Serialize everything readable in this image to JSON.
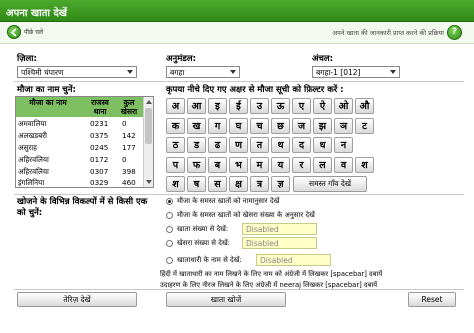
{
  "title": "अपना खाता देखें",
  "subbar": {
    "back_label": "पीछे चलें",
    "help_text": "अपने खाता की जानकारी प्राप्त करने की प्रक्रिया",
    "help_icon": "?"
  },
  "filters": {
    "district": {
      "label": "ज़िला:",
      "value": "पश्चिमी चंपारण"
    },
    "subdivision": {
      "label": "अनुमंडल:",
      "value": "बगहा"
    },
    "circle": {
      "label": "अंचल:",
      "value": "बगहा-1 [012]"
    }
  },
  "mouza": {
    "label": "मौजा का नाम चुनें:",
    "headers": [
      "मौजा का नाम",
      "राजस्व थाना",
      "कुल खेसरा"
    ],
    "rows": [
      [
        "अमवालिया",
        "0231",
        "0"
      ],
      [
        "अलखडबरी",
        "0375",
        "142"
      ],
      [
        "असुराह",
        "0245",
        "177"
      ],
      [
        "अहिरवलिया",
        "0172",
        "0"
      ],
      [
        "अहिरवलिया",
        "0307",
        "398"
      ],
      [
        "इंगलिनिया",
        "0329",
        "460"
      ]
    ]
  },
  "keyboard": {
    "instruction": "कृपया नीचे दिए गए अक्षर से मौजा सूची को फ़िल्टर करें :",
    "rows": [
      [
        "अ",
        "आ",
        "इ",
        "ई",
        "उ",
        "ऊ",
        "ए",
        "ऐ",
        "ओ",
        "औ"
      ],
      [
        "क",
        "ख",
        "ग",
        "घ",
        "च",
        "छ",
        "ज",
        "झ",
        "ञ",
        "ट"
      ],
      [
        "ठ",
        "ड",
        "ढ",
        "ण",
        "त",
        "थ",
        "द",
        "ध",
        "न"
      ],
      [
        "प",
        "फ",
        "ब",
        "भ",
        "म",
        "य",
        "र",
        "ल",
        "व",
        "श"
      ],
      [
        "श",
        "ष",
        "स",
        "क्ष",
        "त्र",
        "ज्ञ"
      ]
    ],
    "all_villages_button": "समस्त गाँव देखें"
  },
  "search": {
    "label": "खोजने के विभिन्न विकल्पों में से किसी एक को चुनें:",
    "options": [
      "मौजा के समस्त खातों को नामानुसार देखें",
      "मौजा के समस्त खातों को खेसरा संख्या के अनुसार देखें",
      "खाता संख्या से देखें:",
      "खेसरा संख्या से देखें:",
      "खाताधारी के नाम से देखें:"
    ],
    "disabled_value": "Disabled",
    "note_line1": "हिंदी में खाताधारी का नाम लिखने के लिए नाम को अंग्रेजी में लिखकर [spacebar] दबायें",
    "note_line2": "उदाहरण के लिए नीरज लिखने के लिए अंग्रेजी में neeraj लिखकर [spacebar] दबायें"
  },
  "buttons": {
    "register": "तेरिज़ देखें",
    "search_account": "खाता खोजें",
    "reset": "Reset"
  }
}
